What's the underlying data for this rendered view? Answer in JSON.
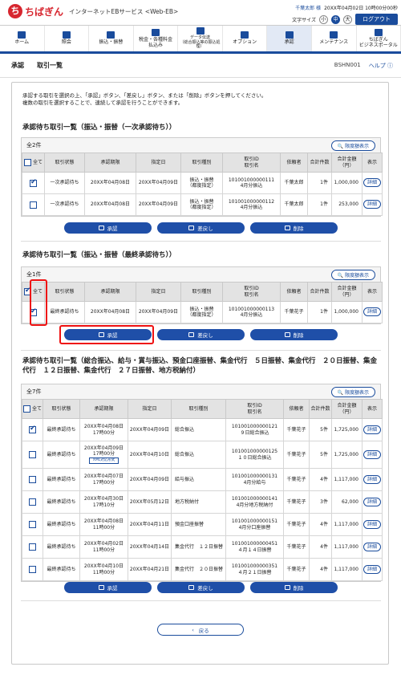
{
  "header": {
    "logo_mark": "ち",
    "logo": "ちばぎん",
    "service": "インターネットEBサービス <Web-EB>",
    "user": "千葉太郎 様",
    "last_login": "20XX年04月02日 10時00分00秒",
    "font_size_label": "文字サイズ",
    "font_small": "小",
    "font_medium": "中",
    "font_large": "大",
    "logout": "ログアウト"
  },
  "nav": [
    {
      "label": "ホーム"
    },
    {
      "label": "照会"
    },
    {
      "label": "振込・振替"
    },
    {
      "label": "税金・各種料金\n払込み"
    },
    {
      "label": "データ伝送\n（総合振込等の振込処理）"
    },
    {
      "label": "オプション"
    },
    {
      "label": "承認"
    },
    {
      "label": "メンテナンス"
    },
    {
      "label": "ちばぎん\nビジネスポータル"
    }
  ],
  "subheader": {
    "title": "承認",
    "page": "取引一覧",
    "screen_id": "BSHN001",
    "help": "ヘルプ"
  },
  "intro": "承認する取引を選択の上、「承認」ボタン、「差戻し」ボタン、または「削除」ボタンを押してください。\n複数の取引を選択することで、連続して承認を行うことができます。",
  "columns": {
    "all": "全て",
    "status": "取引状態",
    "date": "承認期限",
    "specified": "指定日",
    "type": "取引種別",
    "id": "取引ID\n取引名",
    "requester": "依頼者",
    "count": "合計件数",
    "amount": "合計金額\n（円）",
    "show": "表示"
  },
  "limit_btn": "限度額表示",
  "detail": "詳細",
  "buttons": {
    "approve": "承認",
    "return": "差戻し",
    "delete": "削除",
    "back": "戻る"
  },
  "sec1": {
    "title": "承認待ち取引一覧（振込・振替（一次承認待ち））",
    "count": "全2件",
    "rows": [
      {
        "checked": true,
        "status": "一次承認待ち",
        "date": "20XX年04月08日",
        "specified": "20XX年04月09日",
        "type": "振込・振替\n（都度指定）",
        "id": "101001000000111\n4月分振込",
        "requester": "千葉太郎",
        "count": "1件",
        "amount": "1,000,000"
      },
      {
        "checked": false,
        "status": "一次承認待ち",
        "date": "20XX年04月08日",
        "specified": "20XX年04月09日",
        "type": "振込・振替\n（都度指定）",
        "id": "101001000000112\n4月分振込",
        "requester": "千葉太郎",
        "count": "1件",
        "amount": "253,000"
      }
    ]
  },
  "sec2": {
    "title": "承認待ち取引一覧（振込・振替（最終承認待ち））",
    "count": "全1件",
    "rows": [
      {
        "checked": true,
        "status": "最終承認待ち",
        "date": "20XX年04月08日",
        "specified": "20XX年04月09日",
        "type": "振込・振替\n（都度指定）",
        "id": "101001000000113\n4月分振込",
        "requester": "千葉花子",
        "count": "1件",
        "amount": "1,000,000"
      }
    ]
  },
  "sec3": {
    "title": "承認待ち取引一覧（総合振込、給与・賞与振込、預金口座振替、集金代行　５日振替、集金代行　２０日振替、集金代行　１２日振替、集金代行　２７日振替、地方税納付）",
    "count": "全7件",
    "rows": [
      {
        "checked": true,
        "status": "最終承認待ち",
        "date": "20XX年04月08日\n17時00分",
        "tag": "",
        "specified": "20XX年04月09日",
        "type": "総合振込",
        "id": "101001000000121\n９日総合振込",
        "requester": "千葉花子",
        "count": "5件",
        "amount": "1,725,000"
      },
      {
        "checked": false,
        "status": "最終承認待ち",
        "date": "20XX年04月09日\n17時00分",
        "tag": "XML対応形式",
        "specified": "20XX年04月10日",
        "type": "総合振込",
        "id": "101001000000125\n１０日総合振込",
        "requester": "千葉花子",
        "count": "5件",
        "amount": "1,725,000"
      },
      {
        "checked": false,
        "status": "最終承認待ち",
        "date": "20XX年04月07日\n17時00分",
        "tag": "",
        "specified": "20XX年04月09日",
        "type": "給与振込",
        "id": "101001000000131\n4月分給与",
        "requester": "千葉花子",
        "count": "4件",
        "amount": "1,117,000"
      },
      {
        "checked": false,
        "status": "最終承認待ち",
        "date": "20XX年04月30日\n17時10分",
        "tag": "",
        "specified": "20XX年05月12日",
        "type": "地方税納付",
        "id": "101001000000141\n4月分地方税納付",
        "requester": "千葉花子",
        "count": "3件",
        "amount": "62,000"
      },
      {
        "checked": false,
        "status": "最終承認待ち",
        "date": "20XX年04月08日\n11時00分",
        "tag": "",
        "specified": "20XX年04月11日",
        "type": "預金口座振替",
        "id": "101001000000151\n4月分口座振替",
        "requester": "千葉花子",
        "count": "4件",
        "amount": "1,117,000"
      },
      {
        "checked": false,
        "status": "最終承認待ち",
        "date": "20XX年04月02日\n11時00分",
        "tag": "",
        "specified": "20XX年04月14日",
        "type": "集金代行　１２日振替",
        "id": "101001000000451\n４月１４日振替",
        "requester": "千葉花子",
        "count": "4件",
        "amount": "1,117,000"
      },
      {
        "checked": false,
        "status": "最終承認待ち",
        "date": "20XX年04月10日\n11時00分",
        "tag": "",
        "specified": "20XX年04月21日",
        "type": "集金代行　２０日振替",
        "id": "101001000000351\n４月２１日振替",
        "requester": "千葉花子",
        "count": "4件",
        "amount": "1,117,000"
      }
    ]
  },
  "colors": {
    "brand": "#d7262f",
    "primary": "#1f4fa8",
    "highlight": "#ee1111"
  }
}
